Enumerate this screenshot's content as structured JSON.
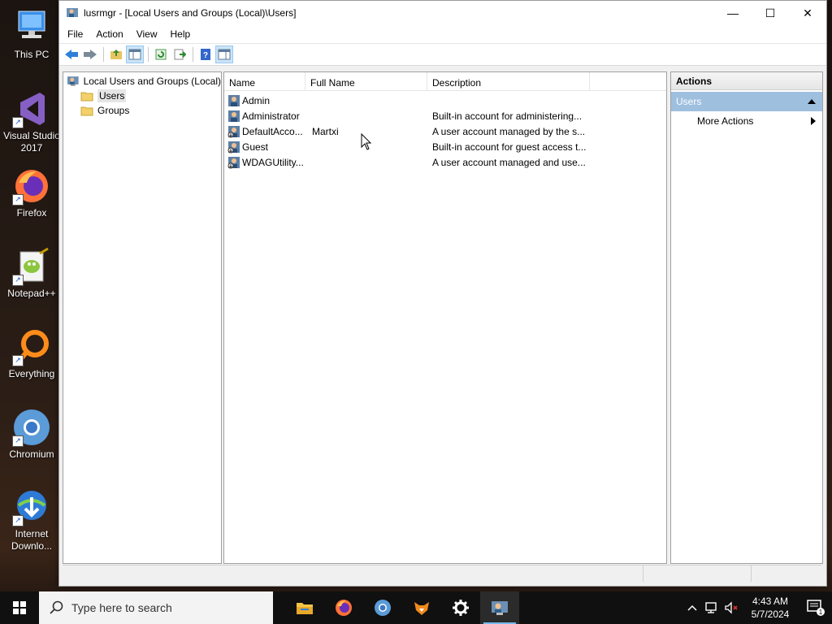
{
  "desktop": {
    "icons": [
      {
        "label": "This PC"
      },
      {
        "label": "Visual Studio 2017"
      },
      {
        "label": "Firefox"
      },
      {
        "label": "Notepad++"
      },
      {
        "label": "Everything"
      },
      {
        "label": "Chromium"
      },
      {
        "label": "Internet Downlo..."
      }
    ]
  },
  "window": {
    "title": "lusrmgr - [Local Users and Groups (Local)\\Users]",
    "minimize": "—",
    "maximize": "☐",
    "close": "✕"
  },
  "menu": [
    "File",
    "Action",
    "View",
    "Help"
  ],
  "tree": {
    "root": "Local Users and Groups (Local)",
    "items": [
      "Users",
      "Groups"
    ],
    "selected": "Users"
  },
  "list": {
    "columns": [
      "Name",
      "Full Name",
      "Description"
    ],
    "rows": [
      {
        "name": "Admin",
        "full_name": "",
        "description": ""
      },
      {
        "name": "Administrator",
        "full_name": "",
        "description": "Built-in account for administering..."
      },
      {
        "name": "DefaultAcco...",
        "full_name": "Martxi",
        "description": "A user account managed by the s..."
      },
      {
        "name": "Guest",
        "full_name": "",
        "description": "Built-in account for guest access t..."
      },
      {
        "name": "WDAGUtility...",
        "full_name": "",
        "description": "A user account managed and use..."
      }
    ]
  },
  "actions": {
    "title": "Actions",
    "group": "Users",
    "items": [
      "More Actions"
    ]
  },
  "taskbar": {
    "search_placeholder": "Type here to search",
    "time": "4:43 AM",
    "date": "5/7/2024",
    "notification_count": "1"
  },
  "colors": {
    "action_group_bg": "#9fbfdf",
    "selection": "#e5e5e5",
    "taskbar": "#101010"
  }
}
